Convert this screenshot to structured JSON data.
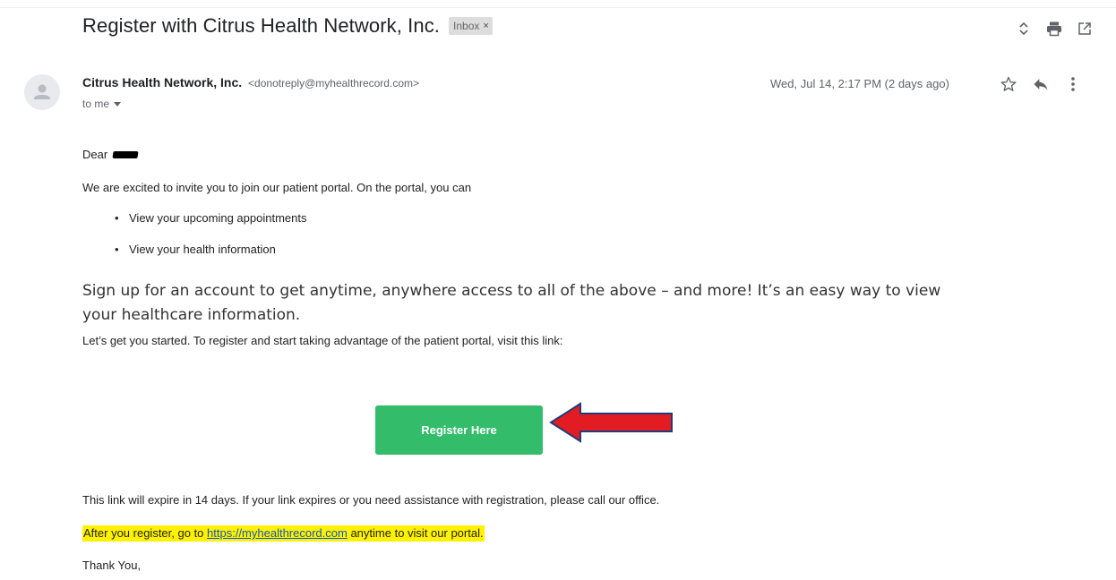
{
  "email": {
    "subject": "Register with Citrus Health Network, Inc.",
    "label_chip": "Inbox",
    "label_chip_close": "×",
    "top_icons": [
      "expand-collapse-icon",
      "print-icon",
      "open-new-window-icon"
    ],
    "sender_name": "Citrus Health Network, Inc.",
    "sender_email": "<donotreply@myhealthrecord.com>",
    "recipient": "to me",
    "date": "Wed, Jul 14, 2:17 PM (2 days ago)",
    "message_icons": [
      "star-icon",
      "reply-icon",
      "more-options-icon"
    ]
  },
  "body": {
    "greeting": "Dear",
    "intro": "We are excited to invite you to join our patient portal. On the portal, you can",
    "bullets": [
      "View your upcoming appointments",
      "View your health information"
    ],
    "signup": "Sign up for an account to get anytime, anywhere access to all of the above – and more! It’s an easy way to view your healthcare information.",
    "started": "Let’s get you started. To register and start taking advantage of the patient portal, visit this link:",
    "register_button": "Register Here",
    "expire": "This link will expire in 14 days. If your link expires or you need assistance with registration, please call our office.",
    "after_prefix": "After you register, go to",
    "after_link": "https://myhealthrecord.com",
    "after_suffix": "anytime to visit our portal.",
    "closing": "Thank You,"
  },
  "colors": {
    "button": "#33bd6b",
    "arrow_fill": "#e31b23",
    "arrow_outline": "#1f3d7a",
    "highlight": "#fff200",
    "link": "#1155cc"
  }
}
